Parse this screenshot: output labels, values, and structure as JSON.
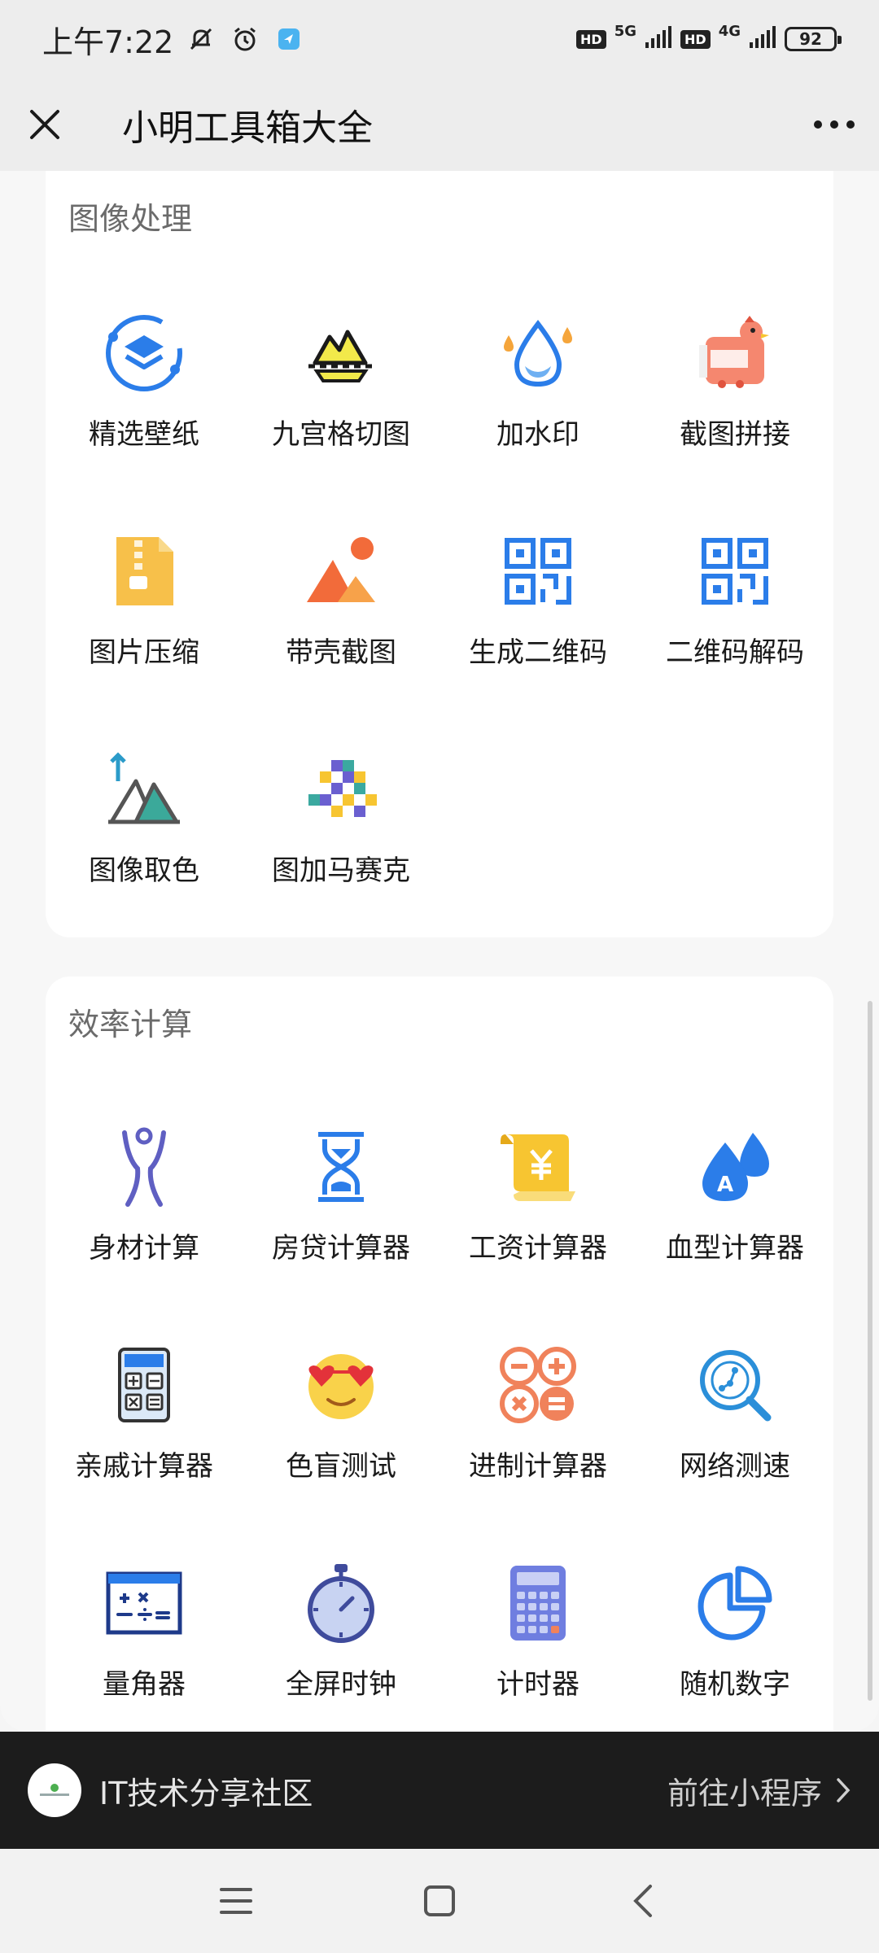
{
  "status_bar": {
    "time": "上午7:22",
    "hd1": "HD",
    "net1": "5G",
    "hd2": "HD",
    "net2": "4G",
    "battery": "92"
  },
  "title_bar": {
    "title": "小明工具箱大全"
  },
  "sections": [
    {
      "title": "图像处理",
      "tools": [
        {
          "label": "精选壁纸",
          "icon": "layers-ring-icon"
        },
        {
          "label": "九宫格切图",
          "icon": "mountain-cut-icon"
        },
        {
          "label": "加水印",
          "icon": "water-drop-icon"
        },
        {
          "label": "截图拼接",
          "icon": "chicken-screenshot-icon"
        },
        {
          "label": "图片压缩",
          "icon": "zip-file-icon"
        },
        {
          "label": "带壳截图",
          "icon": "mountain-sun-icon"
        },
        {
          "label": "生成二维码",
          "icon": "qr-code-icon"
        },
        {
          "label": "二维码解码",
          "icon": "qr-decode-icon"
        },
        {
          "label": "图像取色",
          "icon": "mountain-arrow-icon"
        },
        {
          "label": "图加马赛克",
          "icon": "mosaic-icon"
        }
      ]
    },
    {
      "title": "效率计算",
      "tools": [
        {
          "label": "身材计算",
          "icon": "body-figure-icon"
        },
        {
          "label": "房贷计算器",
          "icon": "hourglass-icon"
        },
        {
          "label": "工资计算器",
          "icon": "yuan-scroll-icon"
        },
        {
          "label": "血型计算器",
          "icon": "blood-drop-icon"
        },
        {
          "label": "亲戚计算器",
          "icon": "calculator-icon"
        },
        {
          "label": "色盲测试",
          "icon": "sunglasses-face-icon"
        },
        {
          "label": "进制计算器",
          "icon": "math-operators-icon"
        },
        {
          "label": "网络测速",
          "icon": "network-search-icon"
        },
        {
          "label": "量角器",
          "icon": "math-board-icon"
        },
        {
          "label": "全屏时钟",
          "icon": "stopwatch-icon"
        },
        {
          "label": "计时器",
          "icon": "keypad-calculator-icon"
        },
        {
          "label": "随机数字",
          "icon": "pie-chart-icon"
        }
      ]
    }
  ],
  "mini_program": {
    "name": "IT技术分享社区",
    "link": "前往小程序"
  },
  "colors": {
    "blue": "#2b7de9",
    "yellow": "#f7c531",
    "orange": "#f5874f",
    "purple": "#6a5fd0"
  }
}
